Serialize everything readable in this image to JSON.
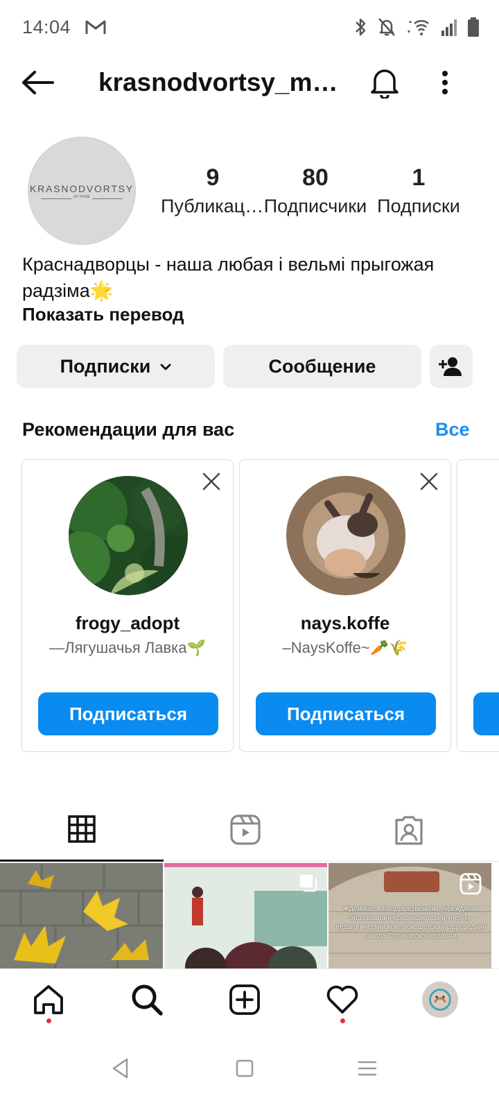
{
  "status_bar": {
    "time": "14:04",
    "icons": [
      "gmail-icon",
      "bluetooth-icon",
      "mute-icon",
      "wifi-icon",
      "signal-icon",
      "battery-icon"
    ]
  },
  "header": {
    "username": "krasnodvortsy_my_home",
    "icons": [
      "back-arrow-icon",
      "bell-icon",
      "more-vertical-icon"
    ]
  },
  "profile": {
    "avatar_brand": "KRASNODVORTSY",
    "avatar_sub": "MY HOME",
    "stats": [
      {
        "value": "9",
        "label": "Публикации"
      },
      {
        "value": "80",
        "label": "Подписчики"
      },
      {
        "value": "1",
        "label": "Подписки"
      }
    ],
    "bio_line1": "Краснадворцы - наша любая і вельмі прыгожая",
    "bio_line2": "радзіма🌟",
    "translate_label": "Показать перевод"
  },
  "actions": {
    "following_label": "Подписки",
    "message_label": "Сообщение"
  },
  "suggestions": {
    "title": "Рекомендации для вас",
    "see_all": "Все",
    "cards": [
      {
        "username": "frogy_adopt",
        "description": "—Лягушачья Лавка🌱",
        "follow_label": "Подписаться"
      },
      {
        "username": "nays.koffe",
        "description": "–NaysKoffe~🥕🌾",
        "follow_label": "Подписаться"
      }
    ]
  },
  "tabs": [
    "grid-icon",
    "reels-icon",
    "tagged-icon"
  ],
  "posts": {
    "post3_text": "Ждём вас в Государственном учреждении образования Краснадворский учебно-педагогический комплекс детский сад-средняя школа Солигорского района"
  },
  "bottom_nav": [
    "home-icon",
    "search-icon",
    "create-icon",
    "activity-icon",
    "profile-avatar"
  ],
  "colors": {
    "accent_blue": "#0a8bf0",
    "link_blue": "#1a8ef0",
    "notification_red": "#ed2c48",
    "button_gray": "#efeff1"
  }
}
